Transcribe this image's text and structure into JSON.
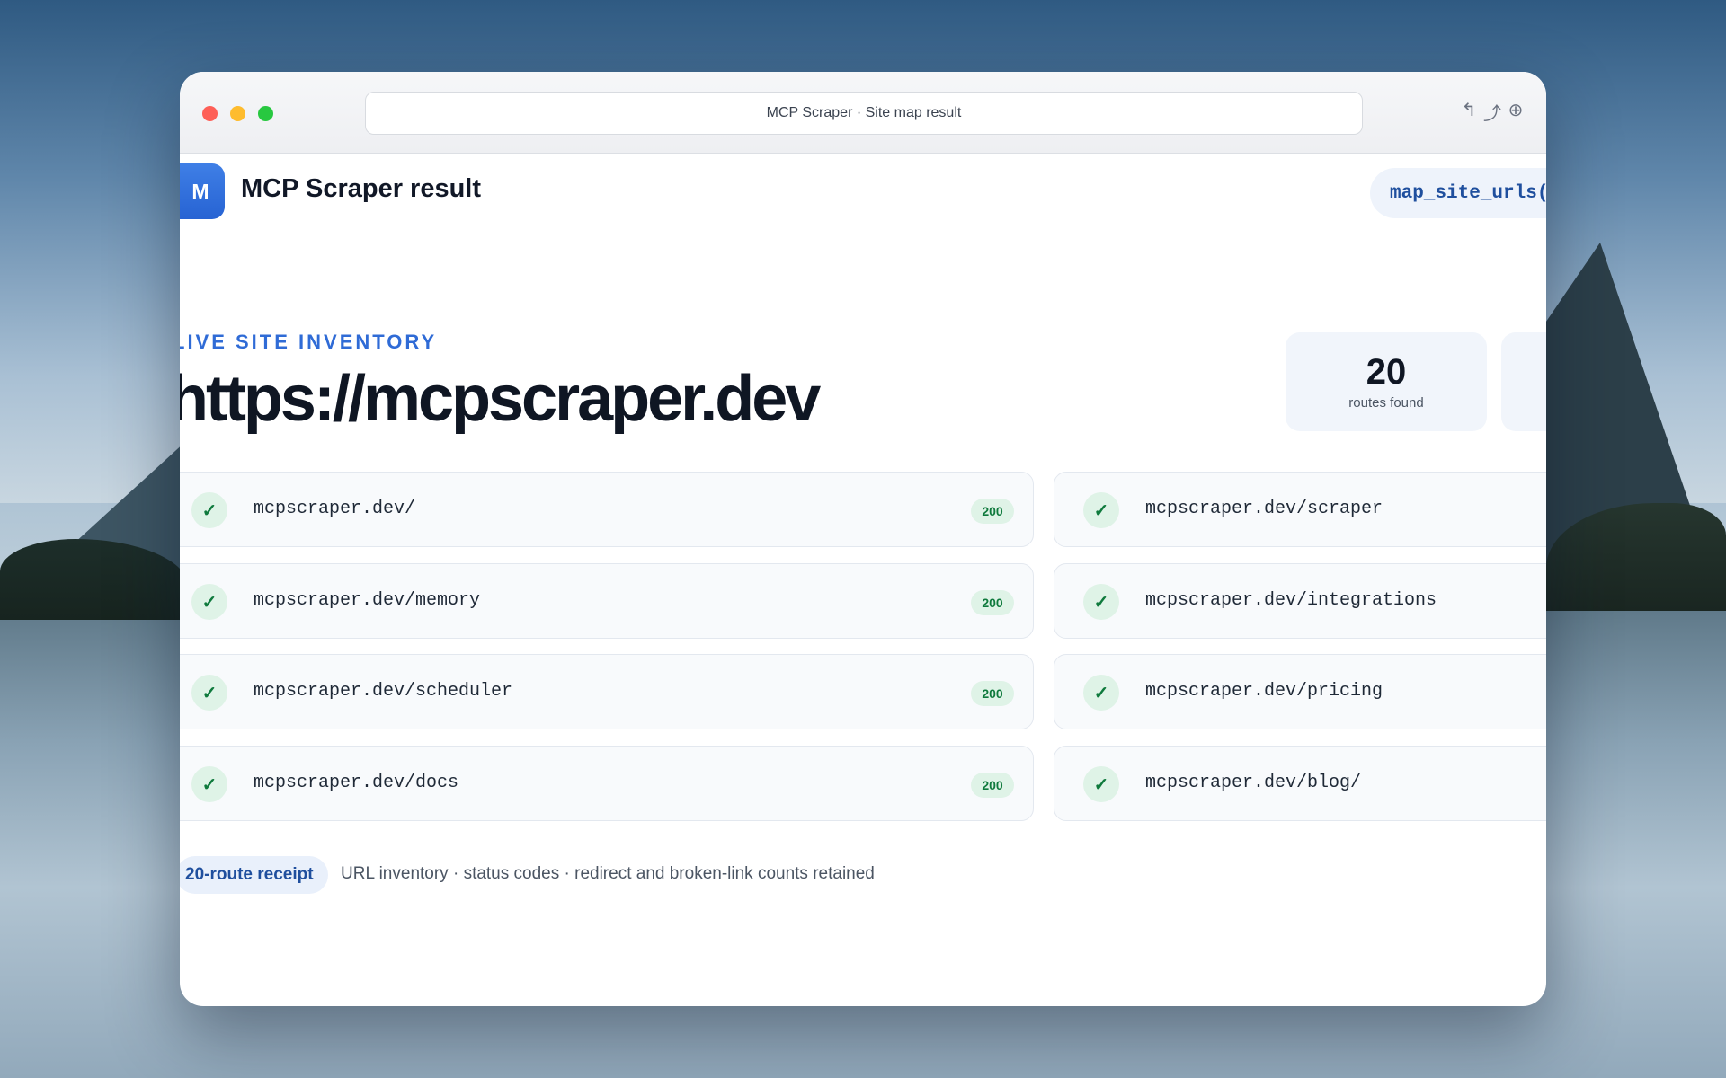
{
  "window": {
    "address_bar": "MCP Scraper · Site map result",
    "toolbar_icons": [
      "back-arrow-icon",
      "share-icon",
      "globe-icon"
    ]
  },
  "header": {
    "logo_letter": "M",
    "title": "MCP Scraper result",
    "tool_chip": "map_site_urls("
  },
  "hero": {
    "eyebrow": "LIVE SITE INVENTORY",
    "url": "https://mcpscraper.dev"
  },
  "stats": [
    {
      "value": "20",
      "label": "routes found"
    }
  ],
  "routes": [
    {
      "url": "mcpscraper.dev/",
      "status": "200",
      "icon": "check-icon"
    },
    {
      "url": "mcpscraper.dev/scraper",
      "status": "",
      "icon": "check-icon"
    },
    {
      "url": "mcpscraper.dev/memory",
      "status": "200",
      "icon": "check-icon"
    },
    {
      "url": "mcpscraper.dev/integrations",
      "status": "",
      "icon": "check-icon"
    },
    {
      "url": "mcpscraper.dev/scheduler",
      "status": "200",
      "icon": "check-icon"
    },
    {
      "url": "mcpscraper.dev/pricing",
      "status": "",
      "icon": "check-icon"
    },
    {
      "url": "mcpscraper.dev/docs",
      "status": "200",
      "icon": "check-icon"
    },
    {
      "url": "mcpscraper.dev/blog/",
      "status": "",
      "icon": "check-icon"
    }
  ],
  "footer": {
    "receipt": "20-route receipt",
    "note": "URL inventory · status codes · redirect and broken-link counts retained"
  },
  "colors": {
    "accent": "#2f6bd6",
    "success": "#0f7a3d",
    "success_bg": "#dff3e7"
  }
}
